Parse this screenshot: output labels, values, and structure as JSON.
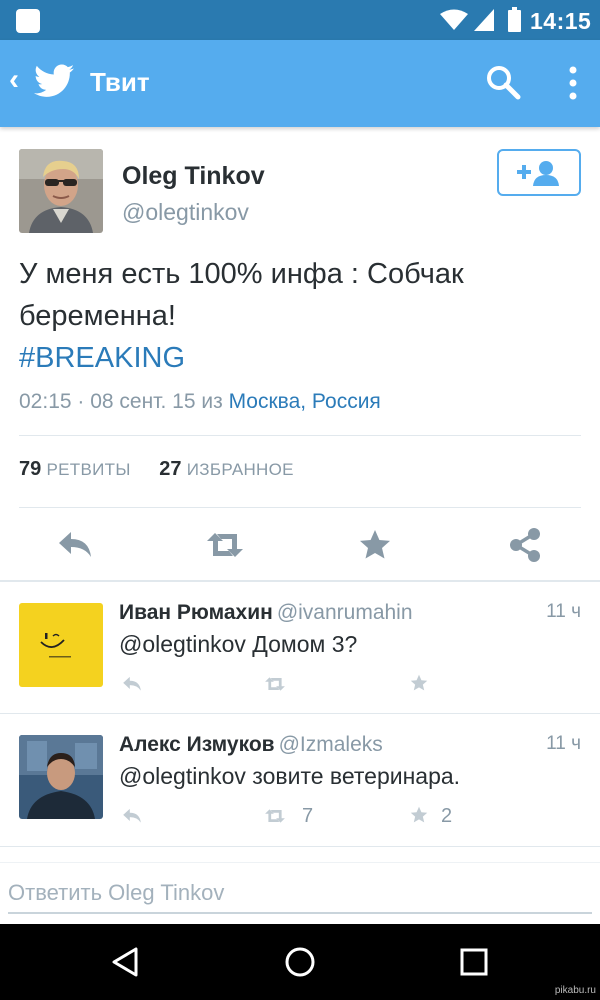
{
  "status_bar": {
    "time": "14:15"
  },
  "app_bar": {
    "title": "Твит",
    "back_glyph": "‹",
    "logo_icon": "twitter-bird-icon",
    "search_icon": "search-icon",
    "more_icon": "more-vertical-icon"
  },
  "tweet": {
    "author_name": "Oleg Tinkov",
    "author_handle": "@olegtinkov",
    "text": "У меня есть 100% инфа : Собчак беременна!",
    "hashtag": "#BREAKING",
    "time": "02:15 · 08 сент. 15",
    "from_word": "из",
    "location": "Москва, Россия",
    "retweets_count": "79",
    "retweets_label": "РЕТВИТЫ",
    "favorites_count": "27",
    "favorites_label": "ИЗБРАННОЕ",
    "actions": [
      "reply-icon",
      "retweet-icon",
      "favorite-icon",
      "share-icon"
    ]
  },
  "replies": [
    {
      "name": "Иван Рюмахин",
      "handle": "@ivanrumahin",
      "time": "11 ч",
      "text": "@olegtinkov Домом 3?",
      "retweets": "",
      "favorites": ""
    },
    {
      "name": "Алекс Измуков",
      "handle": "@Izmaleks",
      "time": "11 ч",
      "text": "@olegtinkov зовите ветеринара.",
      "retweets": "7",
      "favorites": "2"
    }
  ],
  "reply_box": {
    "placeholder": "Ответить Oleg Tinkov"
  },
  "navigation": [
    "back-icon",
    "home-icon",
    "recents-icon"
  ],
  "watermark": "pikabu.ru",
  "colors": {
    "status_bar": "#2a7ab0",
    "app_bar": "#55acee",
    "link": "#2b7bb9",
    "muted": "#8899a6",
    "text": "#292f33"
  }
}
